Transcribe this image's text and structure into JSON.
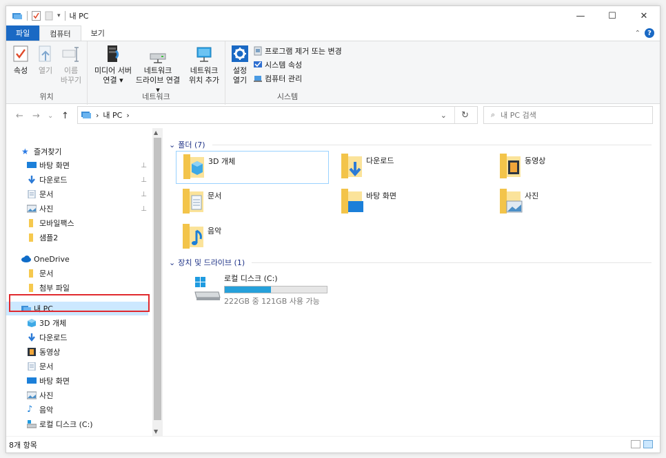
{
  "window": {
    "title": "내 PC",
    "controls": {
      "minimize": "—",
      "maximize": "☐",
      "close": "✕"
    }
  },
  "ribbon_tabs": [
    {
      "label": "파일"
    },
    {
      "label": "컴퓨터"
    },
    {
      "label": "보기"
    }
  ],
  "ribbon": {
    "location": {
      "label": "위치",
      "properties": "속성",
      "open": "열기",
      "rename_line1": "이름",
      "rename_line2": "바꾸기"
    },
    "network": {
      "label": "네트워크",
      "media_line1": "미디어 서버",
      "media_line2": "연결 ▾",
      "map_line1": "네트워크",
      "map_line2": "드라이브 연결 ▾",
      "add_line1": "네트워크",
      "add_line2": "위치 추가"
    },
    "system": {
      "label": "시스템",
      "settings_line1": "설정",
      "settings_line2": "열기",
      "uninstall": "프로그램 제거 또는 변경",
      "sys_props": "시스템 속성",
      "manage": "컴퓨터 관리"
    }
  },
  "address": {
    "path_sep": "›",
    "path": "내 PC",
    "trail": "›",
    "dropdown": "⌄",
    "refresh": "↻",
    "search_placeholder": "내 PC 검색",
    "search_icon": "⌕"
  },
  "nav": {
    "back": "←",
    "forward": "→",
    "recent": "⌄",
    "up": "↑"
  },
  "sidebar": {
    "quick_access": "즐겨찾기",
    "quick_items": [
      {
        "label": "바탕 화면",
        "pin": "📌"
      },
      {
        "label": "다운로드",
        "pin": "📌"
      },
      {
        "label": "문서",
        "pin": "📌"
      },
      {
        "label": "사진",
        "pin": "📌"
      },
      {
        "label": "모바일팩스"
      },
      {
        "label": "샘플2"
      }
    ],
    "onedrive": "OneDrive",
    "onedrive_items": [
      {
        "label": "문서"
      },
      {
        "label": "첨부 파일"
      }
    ],
    "this_pc": "내 PC",
    "pc_items": [
      {
        "label": "3D 개체"
      },
      {
        "label": "다운로드"
      },
      {
        "label": "동영상"
      },
      {
        "label": "문서"
      },
      {
        "label": "바탕 화면"
      },
      {
        "label": "사진"
      },
      {
        "label": "음악"
      },
      {
        "label": "로컬 디스크 (C:)"
      }
    ]
  },
  "content": {
    "folders_header": "폴더 (7)",
    "folders": [
      {
        "label": "3D 개체"
      },
      {
        "label": "다운로드"
      },
      {
        "label": "동영상"
      },
      {
        "label": "문서"
      },
      {
        "label": "바탕 화면"
      },
      {
        "label": "사진"
      },
      {
        "label": "음악"
      }
    ],
    "devices_header": "장치 및 드라이브 (1)",
    "drive": {
      "label": "로컬 디스크 (C:)",
      "free_text": "222GB 중 121GB 사용 가능",
      "used_fraction": 0.455
    }
  },
  "status": {
    "items": "8개 항목"
  },
  "colors": {
    "accent": "#1a69c4",
    "folder": "#f6c94f",
    "selection_box": "#e0282d"
  }
}
